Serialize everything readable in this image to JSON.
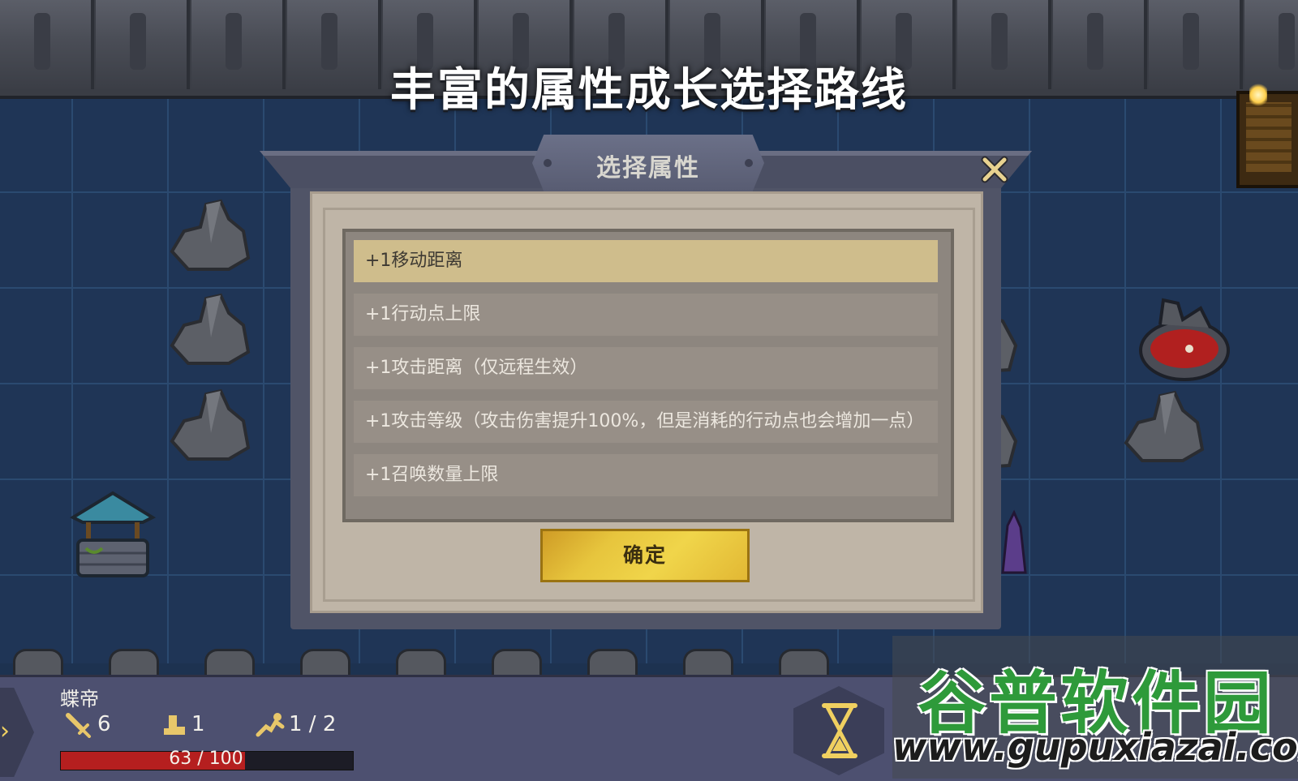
{
  "headline": "丰富的属性成长选择路线",
  "dialog": {
    "title": "选择属性",
    "close_icon": "close-x-icon",
    "options": [
      {
        "label": "+1移动距离",
        "selected": true
      },
      {
        "label": "+1行动点上限",
        "selected": false
      },
      {
        "label": "+1攻击距离（仅远程生效）",
        "selected": false
      },
      {
        "label": "+1攻击等级（攻击伤害提升100%，但是消耗的行动点也会增加一点）",
        "selected": false
      },
      {
        "label": "+1召唤数量上限",
        "selected": false
      }
    ],
    "confirm_label": "确定"
  },
  "hud": {
    "character_name": "蝶帝",
    "attack": "6",
    "move": "1",
    "action_points": "1 / 2",
    "hp_text": "63 / 100",
    "hp_fraction": 0.63,
    "end_turn_icon": "hourglass-icon"
  },
  "watermark": {
    "title": "谷普软件园",
    "url": "www.gupuxiazai.com"
  },
  "colors": {
    "selected_option": "#cfbd8c",
    "confirm_button": "#e7c53d",
    "hp": "#b51f1f",
    "watermark_green": "#2e9a3a"
  }
}
